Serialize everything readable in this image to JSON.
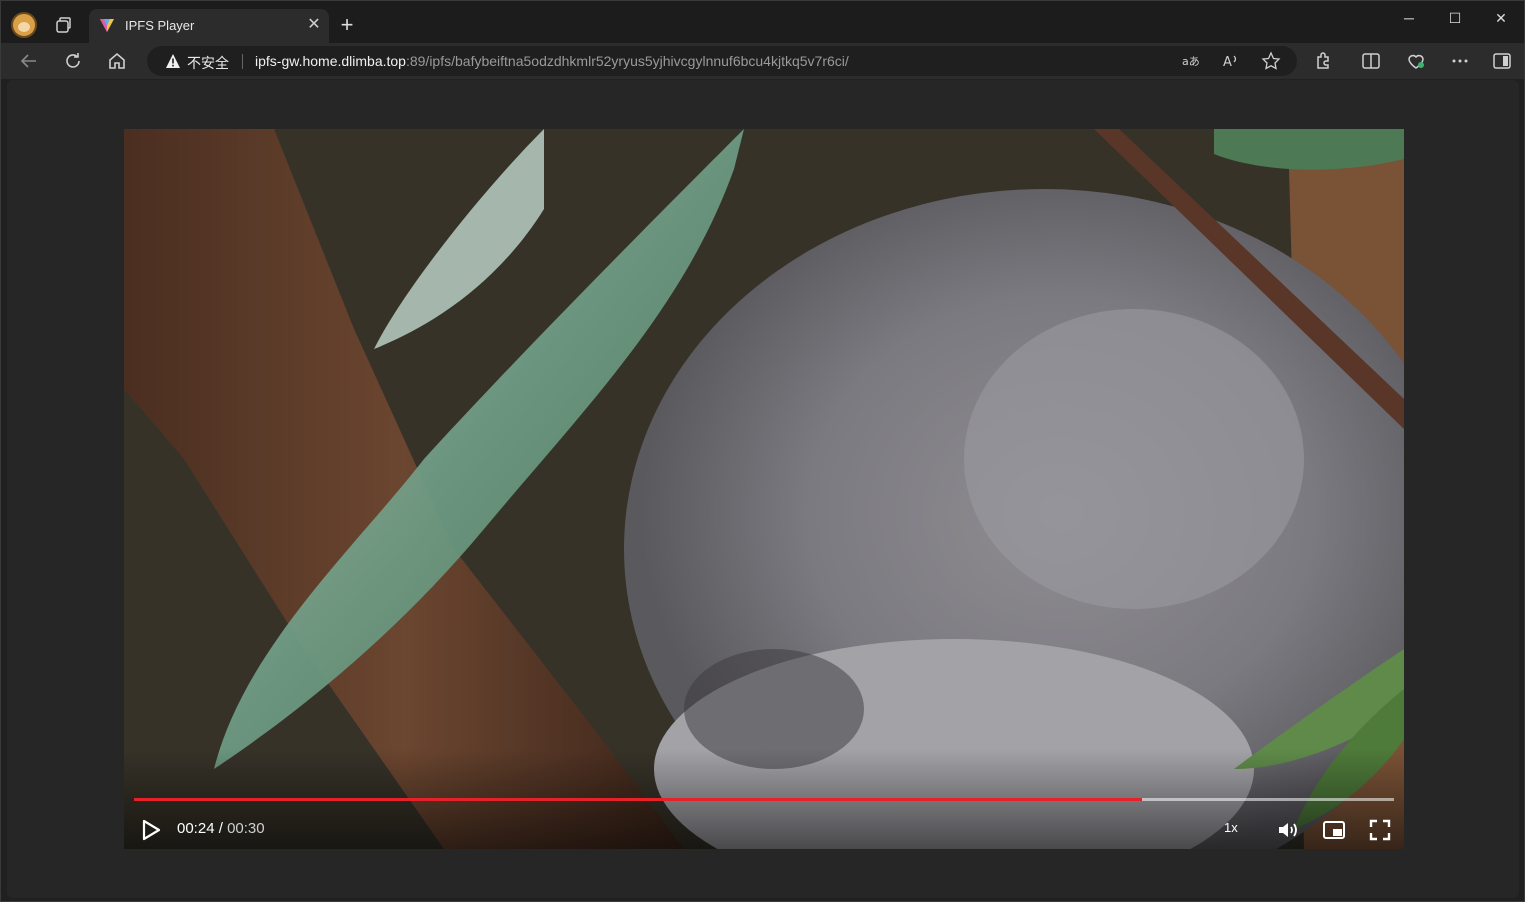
{
  "browser": {
    "tab_title": "IPFS Player",
    "close_tab": "✕",
    "new_tab": "+",
    "security_label": "不安全",
    "url_host": "ipfs-gw.home.dlimba.top",
    "url_rest": ":89/ipfs/bafybeiftna5odzdhkmlr52yryus5yjhivcgylnnuf6bcu4kjtkq5v7r6ci/",
    "window_controls": {
      "minimize": "─",
      "maximize": "☐",
      "close": "✕"
    }
  },
  "player": {
    "current_time": "00:24",
    "separator": " / ",
    "duration": "00:30",
    "speed": "1x",
    "progress": 0.8
  },
  "icons": [
    "profile-avatar",
    "workspaces-icon",
    "back-icon",
    "refresh-icon",
    "home-icon",
    "warning-icon",
    "read-aloud-icon",
    "translate-icon",
    "favorite-icon",
    "extensions-icon",
    "split-screen-icon",
    "browser-essentials-icon",
    "more-icon",
    "sidebar-icon",
    "play-icon",
    "volume-icon",
    "pip-icon",
    "fullscreen-icon"
  ],
  "colors": {
    "progress": "#e5222a",
    "background": "#262626"
  }
}
